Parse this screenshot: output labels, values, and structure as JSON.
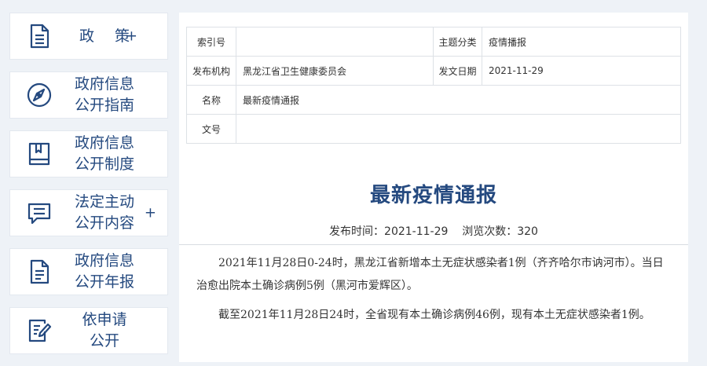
{
  "sidebar": {
    "items": [
      {
        "label": "政 策",
        "plus": "+",
        "icon": "document-icon"
      },
      {
        "label": "政府信息\n公开指南",
        "icon": "compass-icon"
      },
      {
        "label": "政府信息\n公开制度",
        "icon": "book-icon"
      },
      {
        "label": "法定主动\n公开内容",
        "plus": "+",
        "icon": "chat-icon"
      },
      {
        "label": "政府信息\n公开年报",
        "icon": "report-icon"
      },
      {
        "label": "依申请\n公开",
        "icon": "edit-form-icon"
      }
    ]
  },
  "meta": {
    "index_label": "索引号",
    "index_value": "",
    "topic_label": "主题分类",
    "topic_value": "疫情播报",
    "publisher_label": "发布机构",
    "publisher_value": "黑龙江省卫生健康委员会",
    "date_label": "发文日期",
    "date_value": "2021-11-29",
    "name_label": "名称",
    "name_value": "最新疫情通报",
    "docno_label": "文号",
    "docno_value": ""
  },
  "article": {
    "title": "最新疫情通报",
    "publish_time_label": "发布时间：",
    "publish_time": "2021-11-29",
    "views_label": "浏览次数：",
    "views": "320",
    "paragraphs": [
      "2021年11月28日0-24时，黑龙江省新增本土无症状感染者1例（齐齐哈尔市讷河市）。当日治愈出院本土确诊病例5例（黑河市爱辉区）。",
      "截至2021年11月28日24时，全省现有本土确诊病例46例，现有本土无症状感染者1例。"
    ]
  }
}
